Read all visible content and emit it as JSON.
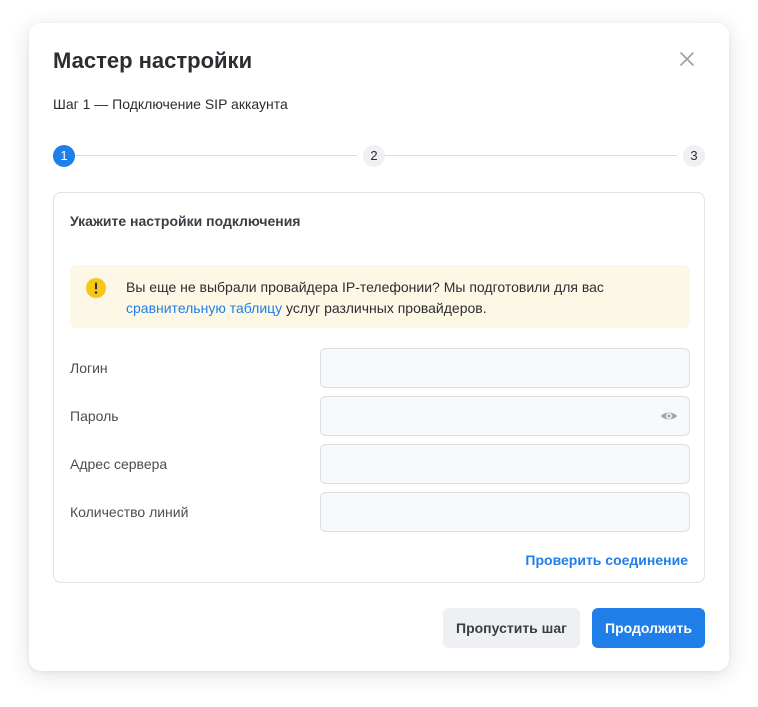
{
  "dialog": {
    "title": "Мастер настройки",
    "subtitle": "Шаг 1 — Подключение SIP аккаунта",
    "close_icon": "close-icon"
  },
  "stepper": {
    "current": 1,
    "steps": [
      {
        "label": "1",
        "state": "active"
      },
      {
        "label": "2",
        "state": "inactive"
      },
      {
        "label": "3",
        "state": "inactive"
      }
    ]
  },
  "panel": {
    "title": "Укажите настройки подключения",
    "notice": {
      "icon": "warning-icon",
      "text_before": "Вы еще не выбрали провайдера IP-телефонии? Мы подготовили для вас ",
      "link": "сравнительную таблицу",
      "text_after": " услуг различных провайдеров."
    },
    "fields": {
      "login": {
        "label": "Логин",
        "value": "",
        "placeholder": ""
      },
      "password": {
        "label": "Пароль",
        "value": "",
        "placeholder": "",
        "icon": "eye-icon"
      },
      "server": {
        "label": "Адрес сервера",
        "value": "",
        "placeholder": ""
      },
      "lines": {
        "label": "Количество линий",
        "value": "",
        "placeholder": ""
      }
    },
    "check_link": "Проверить соединение"
  },
  "footer": {
    "skip_label": "Пропустить шаг",
    "continue_label": "Продолжить"
  },
  "colors": {
    "accent": "#1f7ee8",
    "notice_bg": "#fdf8e5",
    "warning": "#f5c518"
  }
}
